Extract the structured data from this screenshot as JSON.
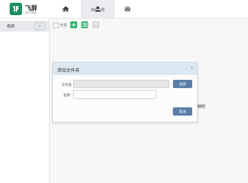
{
  "app": {
    "name": "飞屏",
    "sub": "FEI PING"
  },
  "nav": [
    {
      "label": "首页",
      "icon": "home-icon"
    },
    {
      "label": "我的飞屏",
      "icon": "user-icon"
    },
    {
      "label": "设置",
      "icon": "gear-icon"
    }
  ],
  "sidebar": {
    "items": [
      {
        "label": "视频",
        "icon": "film-icon"
      }
    ]
  },
  "toolbar": {
    "select_all_label": "全选"
  },
  "background_text": "相吧",
  "dialog": {
    "title": "添加文件夹",
    "close_symbol": "×",
    "folder_label": "文件夹",
    "folder_value": "",
    "choose_button": "选择",
    "name_label": "名称",
    "name_value": "",
    "cancel_button": "取消"
  },
  "colors": {
    "brand": "#1c8f60",
    "toolbar_green": "#2fb36e",
    "button_blue": "#5a7ea8"
  }
}
